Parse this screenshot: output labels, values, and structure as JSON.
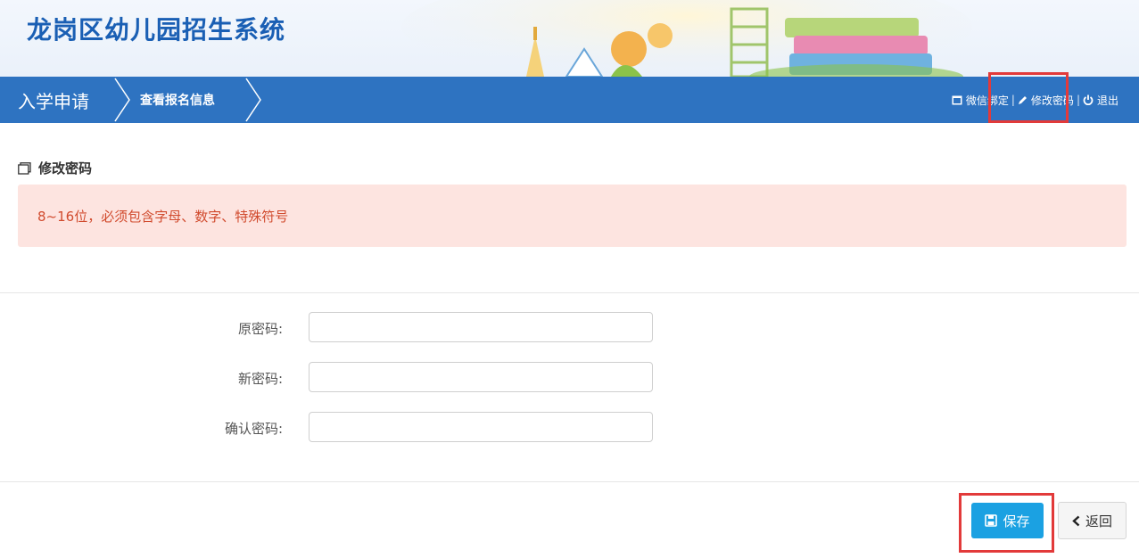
{
  "header": {
    "title": "龙岗区幼儿园招生系统"
  },
  "nav": {
    "primary": "入学申请",
    "secondary": "查看报名信息",
    "right": {
      "wechat": "微信绑定",
      "change_password": "修改密码",
      "logout": "退出",
      "separator": "|"
    }
  },
  "section": {
    "title": "修改密码",
    "alert": "8~16位，必须包含字母、数字、特殊符号"
  },
  "form": {
    "old_password_label": "原密码:",
    "new_password_label": "新密码:",
    "confirm_password_label": "确认密码:"
  },
  "actions": {
    "save": "保存",
    "back": "返回"
  },
  "colors": {
    "nav_bg": "#2e73c1",
    "title": "#1a5fb4",
    "alert_bg": "#fde4e0",
    "alert_text": "#d14b2e",
    "save_bg": "#1ba1e2",
    "highlight": "#e23a3a"
  }
}
